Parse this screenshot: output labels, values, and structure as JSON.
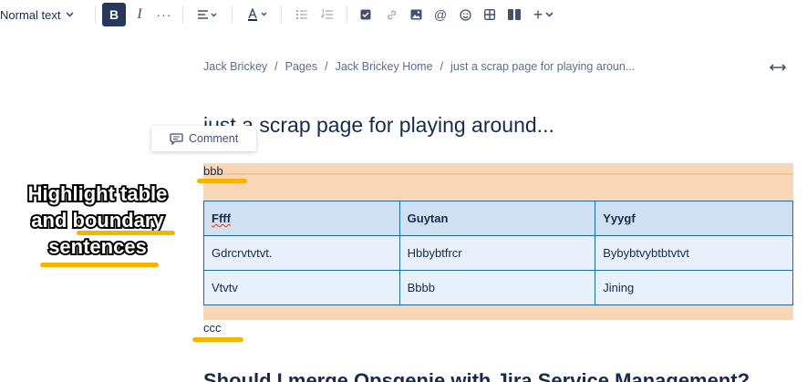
{
  "toolbar": {
    "text_style": "Normal text",
    "bold": "B",
    "italic": "I",
    "more": "···",
    "mention": "@",
    "insert": "+"
  },
  "breadcrumb": {
    "items": [
      "Jack Brickey",
      "Pages",
      "Jack Brickey Home",
      "just a scrap page for playing aroun..."
    ],
    "separator": "/"
  },
  "page": {
    "title": "just a scrap page for playing around...",
    "comment_label": "Comment",
    "para_before": "bbb",
    "para_after": "ccc",
    "next_heading": "Should I merge Opsgenie with Jira Service Management?"
  },
  "table": {
    "headers": [
      "Ffff",
      "Guytan",
      "Yyygf"
    ],
    "rows": [
      [
        "Gdrcrvtvtvt.",
        "Hbbybtfrcr",
        "Bybybtvybtbtvtvt"
      ],
      [
        "Vtvtv",
        "Bbbb",
        "Jining"
      ]
    ]
  },
  "annotation": {
    "lines": [
      "Highlight table",
      "and boundary",
      "sentences"
    ]
  },
  "colors": {
    "highlight": "#f9d6b5",
    "table_border": "#1a6bab",
    "table_header_bg": "#cfe0f3",
    "table_cell_bg": "#e7f0fb",
    "marker": "#f5b400",
    "bold_active": "#253858"
  }
}
